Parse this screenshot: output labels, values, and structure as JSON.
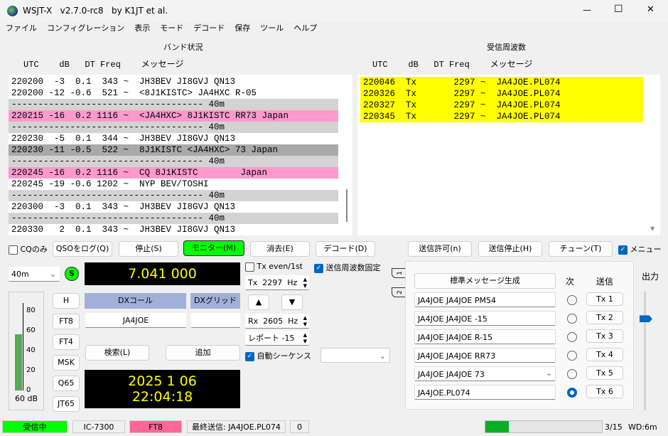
{
  "window": {
    "title": "WSJT-X   v2.7.0-rc8   by K1JT et al.",
    "minimize": "—",
    "maximize": "☐",
    "close": "✕"
  },
  "menu": [
    "ファイル",
    "コンフィグレーション",
    "表示",
    "モード",
    "デコード",
    "保存",
    "ツール",
    "ヘルプ"
  ],
  "band_activity": {
    "title": "バンド状況",
    "header": "UTC    dB   DT Freq    メッセージ",
    "rows": [
      {
        "text": "220200  -3  0.1  343 ~  JH3BEV JI8GVJ QN13",
        "bg": "#ffffff"
      },
      {
        "text": "220200 -12 -0.6  521 ~  <8J1KISTC> JA4HXC R-05",
        "bg": "#ffffff"
      },
      {
        "text": "------------------------------------ 40m",
        "bg": "#d3d3d3"
      },
      {
        "text": "220215 -16  0.2 1116 ~  <JA4HXC> 8J1KISTC RR73 Japan",
        "bg": "#ff99cc"
      },
      {
        "text": "------------------------------------ 40m",
        "bg": "#d3d3d3"
      },
      {
        "text": "220230  -5  0.1  344 ~  JH3BEV JI8GVJ QN13",
        "bg": "#ffffff"
      },
      {
        "text": "220230 -11 -0.5  522 ~  8J1KISTC <JA4HXC> 73 Japan",
        "bg": "#a9a9a9"
      },
      {
        "text": "------------------------------------ 40m",
        "bg": "#d3d3d3"
      },
      {
        "text": "220245 -16  0.2 1116 ~  CQ 8J1KISTC        Japan",
        "bg": "#ff99cc"
      },
      {
        "text": "220245 -19 -0.6 1202 ~  NYP BEV/TOSHI",
        "bg": "#ffffff"
      },
      {
        "text": "------------------------------------ 40m",
        "bg": "#d3d3d3"
      },
      {
        "text": "220300  -3  0.1  343 ~  JH3BEV JI8GVJ QN13",
        "bg": "#ffffff"
      },
      {
        "text": "------------------------------------ 40m",
        "bg": "#d3d3d3"
      },
      {
        "text": "220330   2  0.1  343 ~  JH3BEV JI8GVJ QN13",
        "bg": "#ffffff"
      }
    ]
  },
  "rx_frequency": {
    "title": "受信周波数",
    "header": "UTC    dB   DT Freq    メッセージ",
    "rows": [
      {
        "text": "220046  Tx       2297 ~  JA4JOE.PL074",
        "bg": "#ffff00"
      },
      {
        "text": "220326  Tx       2297 ~  JA4JOE.PL074",
        "bg": "#ffff00"
      },
      {
        "text": "220327  Tx       2297 ~  JA4JOE.PL074",
        "bg": "#ffff00"
      },
      {
        "text": "220345  Tx       2297 ~  JA4JOE.PL074",
        "bg": "#ffff00"
      }
    ]
  },
  "controls": {
    "cq_only": "CQのみ",
    "log_qso": "QSOをログ(Q)",
    "stop": "停止(S)",
    "monitor": "モニター(M)",
    "erase": "消去(E)",
    "decode": "デコード(D)",
    "enable_tx": "送信許可(n)",
    "halt_tx": "送信停止(H)",
    "tune": "チューン(T)",
    "menus": "メニュー"
  },
  "band": "40m",
  "s_button": "S",
  "frequency": "7.041 000",
  "tx_even": "Tx even/1st",
  "hold_tx_freq": "送信周波数固定",
  "tx_hz": "Tx  2297  Hz",
  "rx_hz": "Rx  2605  Hz",
  "report": "レポート -15",
  "auto_seq": "自動シーケンス",
  "up": "▲",
  "down": "▼",
  "dx_call_label": "DXコール",
  "dx_grid_label": "DXグリッド",
  "dx_call": "JA4JOE",
  "dx_grid": "",
  "lookup": "検索(L)",
  "add": "追加",
  "date": "2025 1 06",
  "time": "22:04:18",
  "modes": [
    "H",
    "FT8",
    "FT4",
    "MSK",
    "Q65",
    "JT65"
  ],
  "meter": {
    "ticks": [
      "80",
      "60",
      "40",
      "20",
      "0"
    ],
    "level_db": 57,
    "label": "60 dB"
  },
  "tabs": [
    "1",
    "2"
  ],
  "gen_std": "標準メッセージ生成",
  "next": "次",
  "tx": "送信",
  "messages": [
    {
      "text": "JA4JOE JA4JOE PM54",
      "btn": "Tx 1",
      "selected": false
    },
    {
      "text": "JA4JOE JA4JOE -15",
      "btn": "Tx 2",
      "selected": false
    },
    {
      "text": "JA4JOE JA4JOE R-15",
      "btn": "Tx 3",
      "selected": false
    },
    {
      "text": "JA4JOE JA4JOE RR73",
      "btn": "Tx 4",
      "selected": false
    },
    {
      "text": "JA4JOE JA4JOE 73",
      "btn": "Tx 5",
      "selected": false
    },
    {
      "text": "JA4JOE.PL074",
      "btn": "Tx 6",
      "selected": true
    }
  ],
  "power_label": "出力",
  "power_level": 0.8,
  "status": {
    "receiving": "受信中",
    "rig": "IC-7300",
    "mode": "FT8",
    "last_tx": "最終送信: JA4JOE.PL074",
    "count": "0",
    "progress": "3/15",
    "progress_fraction": 0.2,
    "wd": "WD:6m"
  },
  "colors": {
    "monitor_on": "#00ff00",
    "receiving": "#00ff00",
    "mode_bg": "#ff6699",
    "dx_header": "#a0b0d8",
    "tx_highlight": "#ffff00",
    "accent": "#0067c0"
  }
}
